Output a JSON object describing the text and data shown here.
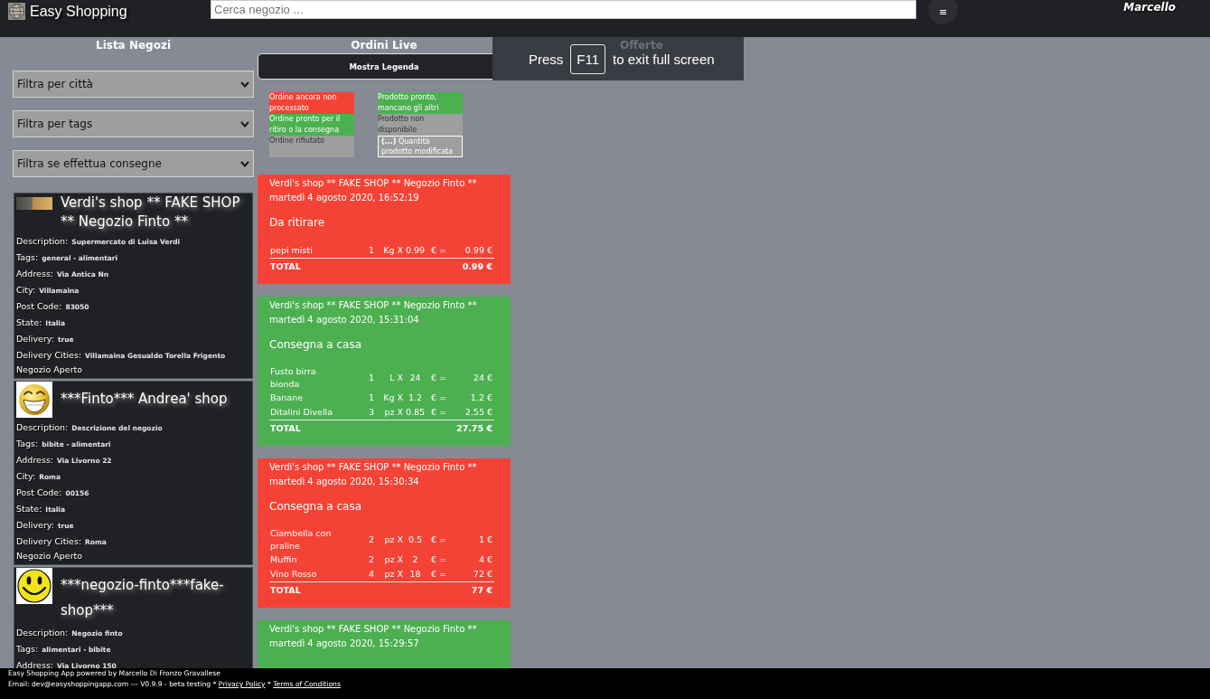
{
  "header": {
    "title": "Easy Shopping",
    "search": {
      "placeholder": "Cerca negozio ..."
    },
    "menu_button": {
      "label": "≡"
    },
    "user": "Marcello"
  },
  "fullscreen_notice": {
    "before": "Press",
    "key": "F11",
    "after": "to exit full screen"
  },
  "shops_panel": {
    "title": "Lista Negozi",
    "filters": [
      {
        "label": "Filtra per città"
      },
      {
        "label": "Filtra per tags"
      },
      {
        "label": "Filtra se effettua consegne"
      }
    ],
    "shops": [
      {
        "kind": "photo",
        "name": "Verdi's shop ** FAKE SHOP ** Negozio Finto **",
        "fields": [
          {
            "label": "Description:",
            "value": "Supermercato di Luisa Verdi"
          },
          {
            "label": "Tags:",
            "value": "general - alimentari"
          },
          {
            "label": "Address:",
            "value": "Via Antica Nn"
          },
          {
            "label": "City:",
            "value": "Villamaina"
          },
          {
            "label": "Post Code:",
            "value": "83050"
          },
          {
            "label": "State:",
            "value": "Italia"
          },
          {
            "label": "Delivery:",
            "value": "true"
          },
          {
            "label": "Delivery Cities:",
            "value": "Villamaina Gesualdo Torella Frigento"
          }
        ],
        "status": "Negozio Aperto"
      },
      {
        "kind": "grin",
        "name": "***Finto*** Andrea' shop",
        "fields": [
          {
            "label": "Description:",
            "value": "Descrizione del negozio"
          },
          {
            "label": "Tags:",
            "value": "bibite - alimentari"
          },
          {
            "label": "Address:",
            "value": "Via Livorno 22"
          },
          {
            "label": "City:",
            "value": "Roma"
          },
          {
            "label": "Post Code:",
            "value": "00156"
          },
          {
            "label": "State:",
            "value": "Italia"
          },
          {
            "label": "Delivery:",
            "value": "true"
          },
          {
            "label": "Delivery Cities:",
            "value": "Roma"
          }
        ],
        "status": "Negozio Aperto"
      },
      {
        "kind": "smiley",
        "name": "***negozio-finto***fake-shop***",
        "fields": [
          {
            "label": "Description:",
            "value": "Negozio finto"
          },
          {
            "label": "Tags:",
            "value": "alimentari - bibite"
          },
          {
            "label": "Address:",
            "value": "Via Livorno 150"
          }
        ]
      }
    ]
  },
  "orders_panel": {
    "title": "Ordini Live",
    "legend_button": "Mostra Legenda",
    "legend": {
      "columns": [
        [
          {
            "kind": "pending",
            "text": "Ordine ancora non processato"
          },
          {
            "kind": "ready",
            "text": "Ordine pronto per il ritiro o la consegna"
          },
          {
            "kind": "rejected",
            "text": "Ordine rifiutato"
          }
        ],
        [
          {
            "kind": "product_ready",
            "text": "Prodotto pronto, mancano gli altri"
          },
          {
            "kind": "unavailable",
            "text": "Prodotto non disponibile"
          },
          {
            "kind": "modified",
            "text": "**(...)** Quantità prodotto modificata"
          }
        ]
      ]
    },
    "orders": [
      {
        "color": "#f44336",
        "shop": "Verdi's shop ** FAKE SHOP ** Negozio Finto **",
        "date": "martedì 4 agosto 2020, 16:52:19",
        "type": "Da ritirare",
        "items": [
          {
            "name": "pepi misti",
            "qty": "1",
            "unit": "Kg X",
            "price": "0.99",
            "sign": "€ =",
            "total": "0.99 €"
          }
        ],
        "total": {
          "label": "TOTAL",
          "value": "0.99 €"
        }
      },
      {
        "color": "#4caf50",
        "shop": "Verdi's shop ** FAKE SHOP ** Negozio Finto **",
        "date": "martedì 4 agosto 2020, 15:31:04",
        "type": "Consegna a casa",
        "items": [
          {
            "name": "Fusto birra bionda",
            "qty": "1",
            "unit": "L X",
            "price": "24",
            "sign": "€ =",
            "total": "24 €"
          },
          {
            "name": "Banane",
            "qty": "1",
            "unit": "Kg X",
            "price": "1.2",
            "sign": "€ =",
            "total": "1.2 €"
          },
          {
            "name": "Ditalini Divella",
            "qty": "3",
            "unit": "pz X",
            "price": "0.85",
            "sign": "€ =",
            "total": "2.55 €"
          }
        ],
        "total": {
          "label": "TOTAL",
          "value": "27.75 €"
        }
      },
      {
        "color": "#f44336",
        "shop": "Verdi's shop ** FAKE SHOP ** Negozio Finto **",
        "date": "martedì 4 agosto 2020, 15:30:34",
        "type": "Consegna a casa",
        "items": [
          {
            "name": "Ciambella con praline",
            "qty": "2",
            "unit": "pz X",
            "price": "0.5",
            "sign": "€ =",
            "total": "1 €"
          },
          {
            "name": "Muffin",
            "qty": "2",
            "unit": "pz X",
            "price": "2",
            "sign": "€ =",
            "total": "4 €"
          },
          {
            "name": "Vino Rosso",
            "qty": "4",
            "unit": "pz X",
            "price": "18",
            "sign": "€ =",
            "total": "72 €"
          }
        ],
        "total": {
          "label": "TOTAL",
          "value": "77 €"
        }
      },
      {
        "color": "#4caf50",
        "shop": "Verdi's shop ** FAKE SHOP ** Negozio Finto **",
        "date": "martedì 4 agosto 2020, 15:29:57"
      }
    ]
  },
  "offers_panel": {
    "title": "Offerte"
  },
  "footer": {
    "credit": "Easy Shopping App powered by Marcello Di Fronzo Gravallese",
    "contact": [
      {
        "kind": "text",
        "text": "Email: dev@easyshoppingapp.com --- V0.9.9 - beta testing * "
      },
      {
        "kind": "link",
        "text": "Privacy Policy"
      },
      {
        "kind": "text",
        "text": " * "
      },
      {
        "kind": "link",
        "text": "Terms of Conditions"
      }
    ]
  }
}
